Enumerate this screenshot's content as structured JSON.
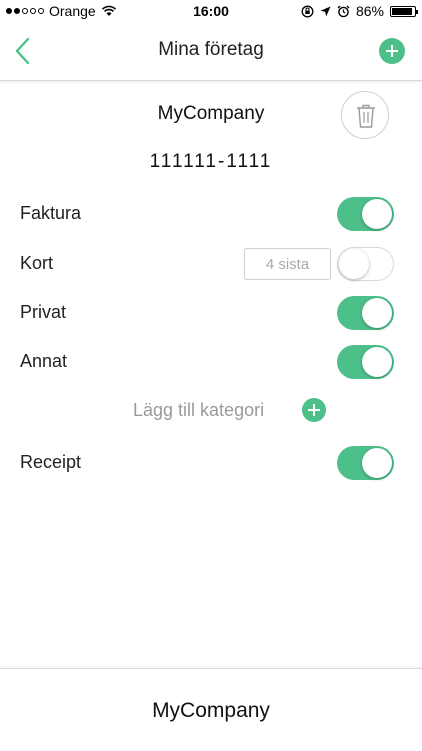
{
  "status_bar": {
    "carrier": "Orange",
    "time": "16:00",
    "battery": "86%",
    "icons": [
      "wifi-icon",
      "orientation-lock-icon",
      "location-arrow-icon",
      "alarm-icon",
      "battery-icon"
    ]
  },
  "navbar": {
    "title": "Mina företag",
    "back_icon": "chevron-left-icon",
    "add_icon": "plus-icon"
  },
  "company": {
    "name": "MyCompany",
    "org_number": "111111-1111",
    "delete_icon": "trash-icon"
  },
  "categories": [
    {
      "label": "Faktura",
      "enabled": true
    },
    {
      "label": "Kort",
      "enabled": false,
      "input_placeholder": "4 sista"
    },
    {
      "label": "Privat",
      "enabled": true
    },
    {
      "label": "Annat",
      "enabled": true
    }
  ],
  "add_category": {
    "label": "Lägg till kategori"
  },
  "receipt": {
    "label": "Receipt",
    "enabled": true
  },
  "footer": {
    "company_name": "MyCompany"
  },
  "colors": {
    "accent": "#4dc08a",
    "text": "#222222",
    "muted": "#9a9a9a"
  }
}
